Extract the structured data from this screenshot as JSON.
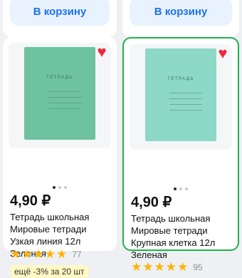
{
  "cards": [
    {
      "cart_label": "В корзину",
      "price": "4,90 ₽",
      "name": "Тетрадь школьная Мировые тетради Узкая линия 12л Зеленая",
      "rating_count": "77",
      "promo": "ещё -3% за 20 шт",
      "cover_title": "ТЕТРАДЬ",
      "cover_color": "#6dc39e"
    },
    {
      "cart_label": "В корзину",
      "price": "4,90 ₽",
      "name": "Тетрадь школьная Мировые тетради Крупная клетка 12л Зеленая",
      "rating_count": "95",
      "cover_title": "ТЕТРАДЬ",
      "cover_color": "#8dd8c6"
    }
  ],
  "icons": {
    "heart": "heart-icon",
    "star": "star-icon"
  },
  "colors": {
    "accent_blue": "#1a73e8",
    "selected_border": "#1fb24a",
    "favorite_red": "#f0263a",
    "star": "#ffb300"
  }
}
